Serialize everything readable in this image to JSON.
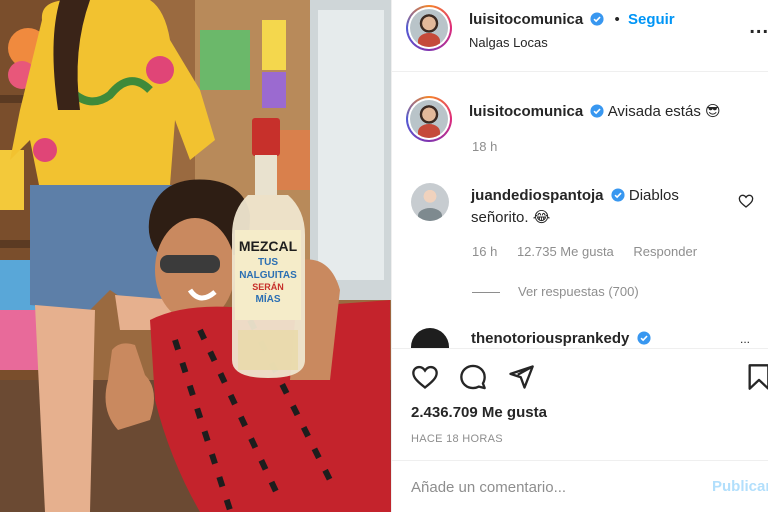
{
  "post": {
    "username": "luisitocomunica",
    "follow_label": "Seguir",
    "location": "Nalgas Locas",
    "more_label": "..."
  },
  "caption": {
    "username": "luisitocomunica",
    "text": "Avisada estás 😎",
    "time": "18 h"
  },
  "comments": [
    {
      "username": "juandediospantoja",
      "text_line1": "Diablos",
      "text_line2": "señorito. 😂",
      "time": "16 h",
      "likes": "12.735 Me gusta",
      "reply_label": "Responder",
      "replies_label": "Ver respuestas (700)"
    },
    {
      "username": "thenotoriousprankedy",
      "more_label": "..."
    }
  ],
  "actions": {
    "likes": "2.436.709 Me gusta",
    "posted": "HACE 18 HORAS"
  },
  "comment_box": {
    "placeholder": "Añade un comentario...",
    "publish_label": "Publicar"
  },
  "photo": {
    "bottle_label_lines": [
      "MEZCAL",
      "TUS",
      "NALGUITAS",
      "SERÁN",
      "MÍAS"
    ]
  },
  "colors": {
    "link_blue": "#0095f6",
    "publish_disabled": "#b2dffc",
    "secondary_text": "#8e8e8e",
    "border": "#efefef"
  }
}
